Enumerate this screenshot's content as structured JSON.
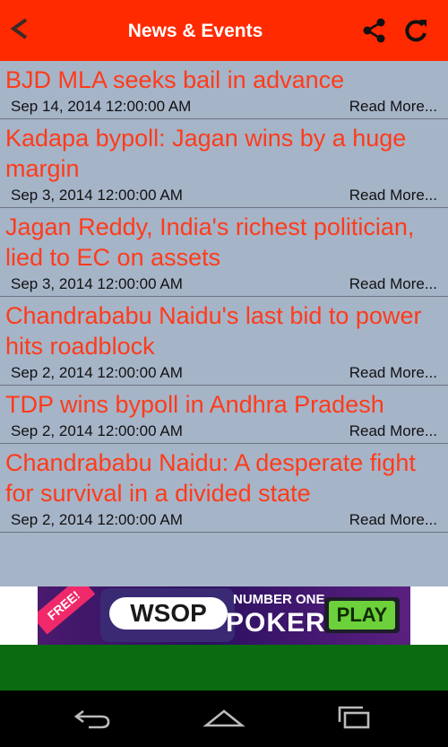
{
  "app": {
    "title": "News & Events"
  },
  "colors": {
    "header": "#ff2a00",
    "list_bg": "#a6b4c8",
    "headline": "#ff3b1a",
    "bottom_bar": "#0a6b10"
  },
  "toolbar": {
    "back_icon": "chevron-left-icon",
    "share_icon": "share-icon",
    "refresh_icon": "refresh-icon"
  },
  "news": {
    "items": [
      {
        "title": "BJD MLA seeks bail in advance",
        "date": "Sep 14, 2014 12:00:00 AM",
        "read_more": "Read More..."
      },
      {
        "title": "Kadapa bypoll: Jagan wins by a huge margin",
        "date": "Sep 3, 2014 12:00:00 AM",
        "read_more": "Read More..."
      },
      {
        "title": "Jagan Reddy, India's richest politician, lied to EC on assets",
        "date": "Sep 3, 2014 12:00:00 AM",
        "read_more": "Read More..."
      },
      {
        "title": "Chandrababu Naidu's last bid to power hits roadblock",
        "date": "Sep 2, 2014 12:00:00 AM",
        "read_more": "Read More..."
      },
      {
        "title": "TDP wins bypoll in Andhra Pradesh",
        "date": "Sep 2, 2014 12:00:00 AM",
        "read_more": "Read More..."
      },
      {
        "title": "Chandrababu Naidu: A desperate fight for survival in a divided state",
        "date": "Sep 2, 2014 12:00:00 AM",
        "read_more": "Read More..."
      }
    ]
  },
  "ad": {
    "free": "FREE!",
    "brand": "WSOP",
    "tagline_top": "NUMBER ONE",
    "tagline_main": "POKER",
    "cta": "PLAY"
  },
  "navbar": {
    "back_icon": "nav-back-icon",
    "home_icon": "nav-home-icon",
    "recents_icon": "nav-recents-icon"
  }
}
